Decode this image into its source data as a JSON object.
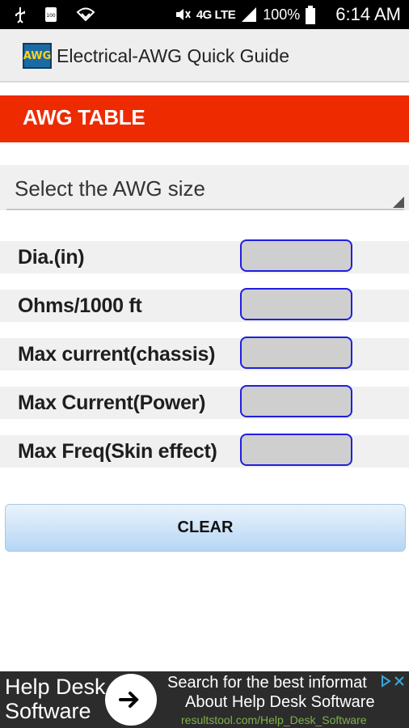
{
  "status_bar": {
    "network": "4G LTE",
    "battery": "100%",
    "time": "6:14 AM",
    "icons": [
      "usb-icon",
      "sim-icon",
      "wifi-hotspot-icon",
      "mute-icon",
      "vibrate-icon",
      "signal-icon",
      "battery-icon"
    ]
  },
  "app": {
    "logo_text": "AWG",
    "title": "Electrical-AWG Quick Guide"
  },
  "banner": {
    "title": "AWG TABLE",
    "color": "#ee2a00"
  },
  "spinner": {
    "selected": "Select the AWG size"
  },
  "fields": [
    {
      "label": "Dia.(in)",
      "value": ""
    },
    {
      "label": "Ohms/1000 ft",
      "value": ""
    },
    {
      "label": "Max current(chassis)",
      "value": ""
    },
    {
      "label": "Max Current(Power)",
      "value": ""
    },
    {
      "label": "Max Freq(Skin effect)",
      "value": ""
    }
  ],
  "clear_button": {
    "label": "CLEAR"
  },
  "ad": {
    "left_text_line1": "Help Desk",
    "left_text_line2": "Software",
    "headline": "Search for the best informat",
    "subline": "About Help Desk Software",
    "url": "resultstool.com/Help_Desk_Software"
  }
}
